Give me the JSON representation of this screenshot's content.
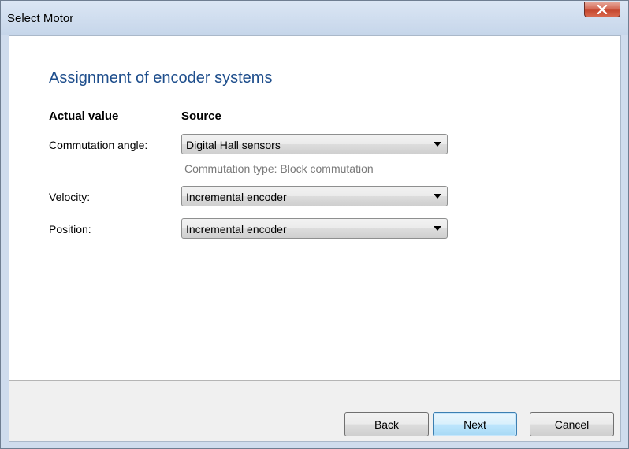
{
  "window": {
    "title": "Select Motor"
  },
  "page": {
    "heading": "Assignment of encoder systems",
    "columns": {
      "actual_value": "Actual value",
      "source": "Source"
    },
    "rows": [
      {
        "label": "Commutation angle:",
        "value": "Digital Hall sensors"
      },
      {
        "label": "Velocity:",
        "value": "Incremental encoder"
      },
      {
        "label": "Position:",
        "value": "Incremental encoder"
      }
    ],
    "commutation_hint": "Commutation type: Block commutation"
  },
  "footer": {
    "back_label": "Back",
    "next_label": "Next",
    "cancel_label": "Cancel"
  },
  "colors": {
    "heading": "#1e4e8c",
    "close_button": "#c5472f",
    "hint_text": "#7a7a7a"
  },
  "icons": {
    "close": "close-icon",
    "dropdown": "chevron-down-icon"
  }
}
